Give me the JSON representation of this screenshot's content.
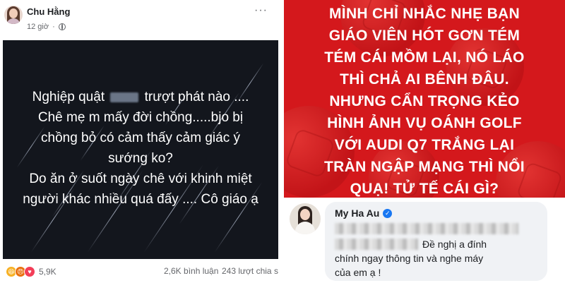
{
  "post": {
    "author": "Chu Hằng",
    "time": "12 giờ",
    "dot": "·",
    "more": "···",
    "lines": [
      "trượt phát nào ....",
      "Chê mẹ m mấy đời chồng.....bjo bị",
      "chồng bỏ có cảm thấy cảm giác ý",
      "sướng ko?",
      "Do ăn ở suốt ngày chê với khinh miệt",
      "người khác nhiều quá đấy .... Cô giáo ạ"
    ],
    "line1_prefix": "Nghiệp quật",
    "reaction_count": "5,9K",
    "comments": "2,6K bình luận",
    "shares": "243 lượt chia s",
    "reaction_icons": [
      "haha",
      "angry",
      "love"
    ]
  },
  "poster": {
    "background": "#d4181c",
    "lines": [
      "MÌNH CHỈ NHẮC NHẸ BẠN",
      "GIÁO VIÊN HÓT GƠN TÉM",
      "TÉM CÁI MỒM LẠI, NÓ LÁO",
      "THÌ CHẢ AI BÊNH ĐÂU.",
      "NHƯNG CẨN TRỌNG KẺO",
      "HÌNH ẢNH VỤ OÁNH GOLF",
      "VỚI AUDI Q7 TRẮNG LẠI",
      "TRÀN NGẬP MẠNG THÌ NỔI",
      "QUẠ! TỬ TẾ CÁI GÌ?"
    ]
  },
  "comment": {
    "name": "My Ha Au",
    "verified_icon": "check",
    "partial": "",
    "lines": [
      "Đề nghị a đính",
      "chính ngay thông tin và nghe máy",
      "của em ạ !"
    ]
  }
}
